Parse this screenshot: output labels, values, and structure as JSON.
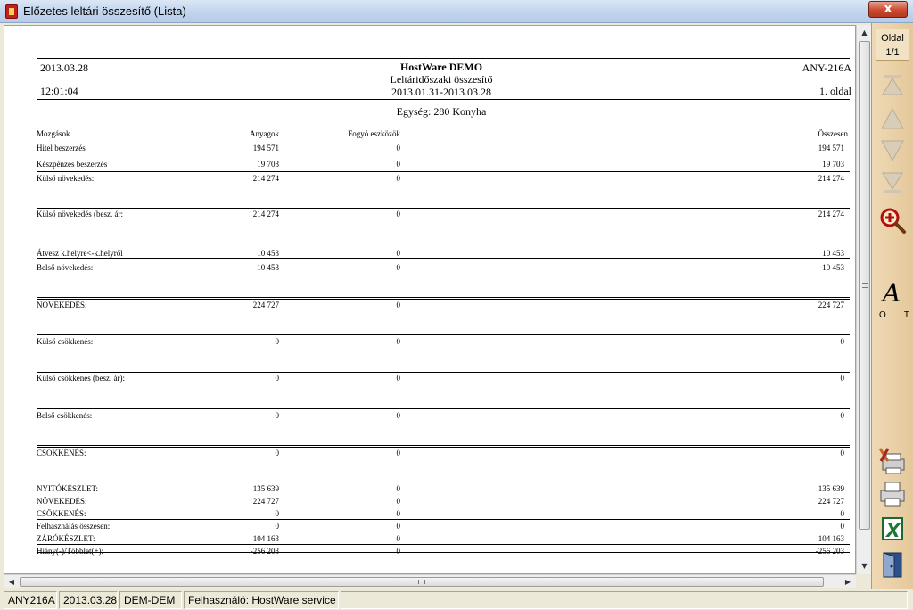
{
  "window": {
    "title": "Előzetes leltári összesítő (Lista)",
    "close_label": "x"
  },
  "report": {
    "date": "2013.03.28",
    "time": "12:01:04",
    "company": "HostWare DEMO",
    "subtitle": "Leltáridőszaki összesítő",
    "period": "2013.01.31-2013.03.28",
    "code": "ANY-216A",
    "page": "1. oldal",
    "unit": "Egység: 280 Konyha",
    "columns": {
      "label": "Mozgások",
      "a": "Anyagok",
      "f": "Fogyó eszközök",
      "o": "Összesen"
    },
    "rows": [
      {
        "label": "Hitel beszerzés",
        "a": "194 571",
        "f": "0",
        "o": "194 571"
      },
      {
        "label": "Készpénzes beszerzés",
        "a": "19 703",
        "f": "0",
        "o": "19 703"
      },
      {
        "label": "Külső növekedés:",
        "a": "214 274",
        "f": "0",
        "o": "214 274"
      },
      {
        "label": "Külső növekedés (besz. ár:",
        "a": "214 274",
        "f": "0",
        "o": "214 274"
      },
      {
        "label": "Átvesz k.helyre<-k.helyről",
        "a": "10 453",
        "f": "0",
        "o": "10 453"
      },
      {
        "label": "Belső növekedés:",
        "a": "10 453",
        "f": "0",
        "o": "10 453"
      },
      {
        "label": "NÖVEKEDÉS:",
        "a": "224 727",
        "f": "0",
        "o": "224 727"
      },
      {
        "label": "Külső csökkenés:",
        "a": "0",
        "f": "0",
        "o": "0"
      },
      {
        "label": "Külső csökkenés (besz. ár):",
        "a": "0",
        "f": "0",
        "o": "0"
      },
      {
        "label": "Belső csökkenés:",
        "a": "0",
        "f": "0",
        "o": "0"
      },
      {
        "label": "CSÖKKENÉS:",
        "a": "0",
        "f": "0",
        "o": "0"
      },
      {
        "label": "NYITÓKÉSZLET:",
        "a": "135 639",
        "f": "0",
        "o": "135 639"
      },
      {
        "label": "NÖVEKEDÉS:",
        "a": "224 727",
        "f": "0",
        "o": "224 727"
      },
      {
        "label": "CSÖKKENÉS:",
        "a": "0",
        "f": "0",
        "o": "0"
      },
      {
        "label": "Felhasználás összesen:",
        "a": "0",
        "f": "0",
        "o": "0"
      },
      {
        "label": "ZÁRÓKÉSZLET:",
        "a": "104 163",
        "f": "0",
        "o": "104 163"
      },
      {
        "label": "Hiány(-)/Többlet(+):",
        "a": "-256 203",
        "f": "0",
        "o": "-256 203"
      }
    ]
  },
  "toolbar": {
    "page_label": "Oldal",
    "page_value": "1/1",
    "ot_o": "O",
    "ot_t": "T",
    "icons": [
      "first-page-icon",
      "previous-page-icon",
      "next-page-icon",
      "last-page-icon",
      "zoom-icon",
      "font-icon",
      "printer-setup-icon",
      "printer-icon",
      "excel-export-icon",
      "exit-door-icon"
    ]
  },
  "statusbar": {
    "code": "ANY216A",
    "date": "2013.03.28",
    "db": "DEM-DEM",
    "user": "Felhasználó: HostWare service"
  },
  "colors": {
    "toolbar_bg": "#e4c89b",
    "title_bg": "#c3d6ee",
    "close_red": "#c94a2f"
  }
}
